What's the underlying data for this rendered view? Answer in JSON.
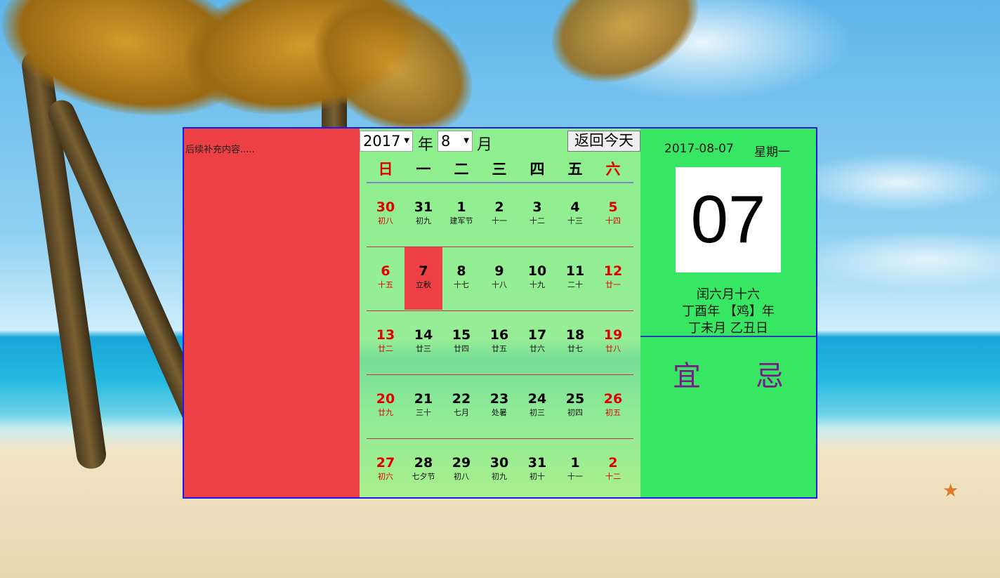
{
  "left_panel": {
    "note": "后续补充内容....."
  },
  "toolbar": {
    "year_value": "2017",
    "year_label": "年",
    "month_value": "8",
    "month_label": "月",
    "today_button": "返回今天"
  },
  "weekdays": [
    "日",
    "一",
    "二",
    "三",
    "四",
    "五",
    "六"
  ],
  "weeks": [
    [
      {
        "d": "30",
        "l": "初八"
      },
      {
        "d": "31",
        "l": "初九"
      },
      {
        "d": "1",
        "l": "建军节"
      },
      {
        "d": "2",
        "l": "十一"
      },
      {
        "d": "3",
        "l": "十二"
      },
      {
        "d": "4",
        "l": "十三"
      },
      {
        "d": "5",
        "l": "十四"
      }
    ],
    [
      {
        "d": "6",
        "l": "十五"
      },
      {
        "d": "7",
        "l": "立秋"
      },
      {
        "d": "8",
        "l": "十七"
      },
      {
        "d": "9",
        "l": "十八"
      },
      {
        "d": "10",
        "l": "十九"
      },
      {
        "d": "11",
        "l": "二十"
      },
      {
        "d": "12",
        "l": "廿一"
      }
    ],
    [
      {
        "d": "13",
        "l": "廿二"
      },
      {
        "d": "14",
        "l": "廿三"
      },
      {
        "d": "15",
        "l": "廿四"
      },
      {
        "d": "16",
        "l": "廿五"
      },
      {
        "d": "17",
        "l": "廿六"
      },
      {
        "d": "18",
        "l": "廿七"
      },
      {
        "d": "19",
        "l": "廿八"
      }
    ],
    [
      {
        "d": "20",
        "l": "廿九"
      },
      {
        "d": "21",
        "l": "三十"
      },
      {
        "d": "22",
        "l": "七月"
      },
      {
        "d": "23",
        "l": "处暑"
      },
      {
        "d": "24",
        "l": "初三"
      },
      {
        "d": "25",
        "l": "初四"
      },
      {
        "d": "26",
        "l": "初五"
      }
    ],
    [
      {
        "d": "27",
        "l": "初六"
      },
      {
        "d": "28",
        "l": "七夕节"
      },
      {
        "d": "29",
        "l": "初八"
      },
      {
        "d": "30",
        "l": "初九"
      },
      {
        "d": "31",
        "l": "初十"
      },
      {
        "d": "1",
        "l": "十一"
      },
      {
        "d": "2",
        "l": "十二"
      }
    ]
  ],
  "selected_day": "7",
  "details": {
    "date": "2017-08-07",
    "weekday": "星期一",
    "big_day": "07",
    "lunar_date": "闰六月十六",
    "year_ganzhi": "丁酉年 【鸡】年",
    "month_day_ganzhi": "丁未月 乙丑日",
    "yi": "宜",
    "ji": "忌"
  },
  "colors": {
    "left_panel": "#ec4044",
    "right_panel": "#37e763",
    "selected_day": "#ec4044",
    "weekend_text": "#e20000",
    "panel_border": "#1a1af0",
    "yi_ji_text": "#7a1a8a"
  },
  "icons": {
    "dropdown": "triangle-down-icon"
  }
}
